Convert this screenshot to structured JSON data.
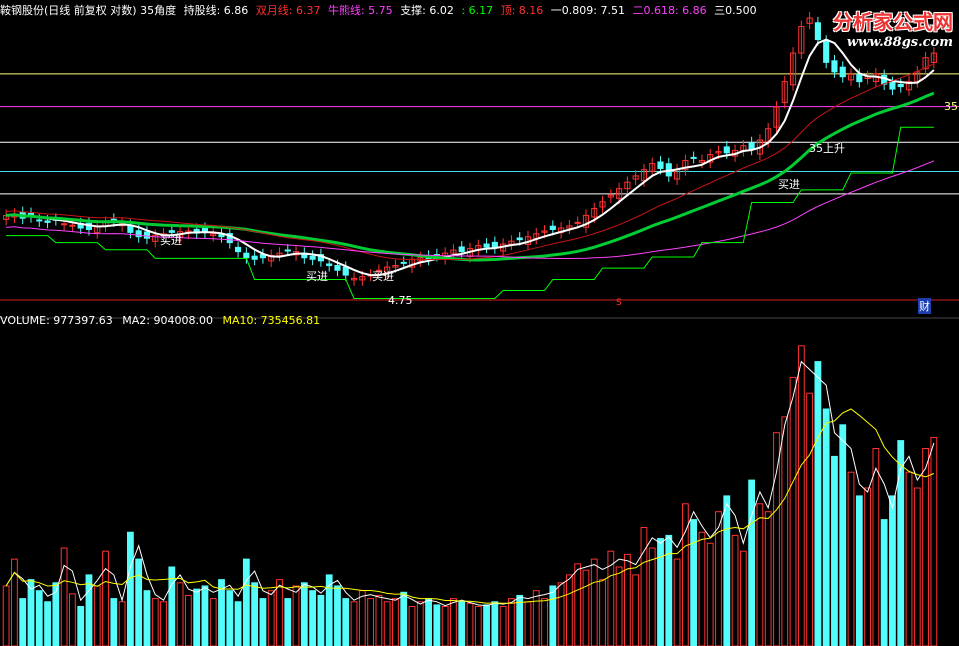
{
  "header": {
    "items": [
      {
        "text": "鞍钢股份(日线 前复权 对数) 35角度",
        "color": "#ffffff"
      },
      {
        "text": "持股线: 6.86",
        "color": "#ffffff"
      },
      {
        "text": "双月线: 6.37",
        "color": "#ff3030"
      },
      {
        "text": "牛熊线: 5.75",
        "color": "#ff40ff"
      },
      {
        "text": "支撑: 6.02",
        "color": "#ffffff"
      },
      {
        "text": ": 6.17",
        "color": "#00ff00"
      },
      {
        "text": "顶: 8.16",
        "color": "#ff3030"
      },
      {
        "text": "一0.809: 7.51",
        "color": "#ffffff"
      },
      {
        "text": "二0.618: 6.86",
        "color": "#ff40ff"
      },
      {
        "text": "三0.500",
        "color": "#ffffff"
      }
    ]
  },
  "volume_header": {
    "items": [
      {
        "text": "VOLUME: 977397.63",
        "color": "#ffffff"
      },
      {
        "text": "MA2: 904008.00",
        "color": "#ffffff"
      },
      {
        "text": "MA10: 735456.81",
        "color": "#ffff00"
      }
    ]
  },
  "watermark": {
    "title": "分析家公式网",
    "url": "www.88gs.com"
  },
  "annotations": {
    "buy": "买进",
    "up35": "35上升",
    "low_label": "4.75",
    "right_label": "35",
    "fin_badge": "财",
    "s_mark": "S"
  },
  "colors": {
    "up": "#ff3232",
    "down": "#54fcfc",
    "ma_white": "#ffffff",
    "ma_green": "#00cc33",
    "ma_red": "#c81414",
    "ma_magenta": "#ff40ff",
    "support": "#00ff00",
    "fib_top": "#ffff80",
    "fib_mag": "#ff40ff",
    "fib_white": "#ffffff",
    "fib_cyan": "#40e0e0",
    "bottom_red": "#d21e1e",
    "vol_ma2": "#ffffff",
    "vol_ma10": "#ffff00"
  },
  "chart_data": {
    "type": "candlestick",
    "closes": [
      5.7,
      5.72,
      5.66,
      5.68,
      5.62,
      5.6,
      5.64,
      5.58,
      5.56,
      5.52,
      5.5,
      5.55,
      5.6,
      5.62,
      5.58,
      5.46,
      5.4,
      5.38,
      5.42,
      5.44,
      5.46,
      5.47,
      5.48,
      5.45,
      5.46,
      5.44,
      5.4,
      5.32,
      5.2,
      5.12,
      5.1,
      5.12,
      5.15,
      5.18,
      5.22,
      5.2,
      5.12,
      5.1,
      5.08,
      5.02,
      4.96,
      4.9,
      4.86,
      4.88,
      4.9,
      4.96,
      5.0,
      5.02,
      5.06,
      5.1,
      5.12,
      5.1,
      5.15,
      5.18,
      5.22,
      5.2,
      5.24,
      5.28,
      5.26,
      5.25,
      5.3,
      5.34,
      5.36,
      5.4,
      5.44,
      5.48,
      5.5,
      5.52,
      5.55,
      5.6,
      5.7,
      5.8,
      5.9,
      6.0,
      6.1,
      6.2,
      6.3,
      6.4,
      6.5,
      6.42,
      6.3,
      6.4,
      6.55,
      6.6,
      6.55,
      6.65,
      6.7,
      6.68,
      6.72,
      6.8,
      6.74,
      6.9,
      7.1,
      7.5,
      8.0,
      8.6,
      9.2,
      9.4,
      8.9,
      8.4,
      8.2,
      8.1,
      8.15,
      8.0,
      8.1,
      8.16,
      7.95,
      7.85,
      7.9,
      8.0,
      8.2,
      8.5,
      8.6
    ],
    "volumes": [
      0.38,
      0.55,
      0.3,
      0.42,
      0.35,
      0.28,
      0.4,
      0.62,
      0.33,
      0.25,
      0.45,
      0.38,
      0.6,
      0.3,
      0.28,
      0.72,
      0.55,
      0.35,
      0.3,
      0.28,
      0.5,
      0.4,
      0.32,
      0.36,
      0.38,
      0.3,
      0.42,
      0.35,
      0.28,
      0.55,
      0.4,
      0.3,
      0.35,
      0.42,
      0.3,
      0.38,
      0.4,
      0.35,
      0.32,
      0.45,
      0.38,
      0.3,
      0.28,
      0.35,
      0.3,
      0.32,
      0.28,
      0.3,
      0.34,
      0.25,
      0.28,
      0.3,
      0.26,
      0.25,
      0.3,
      0.28,
      0.27,
      0.25,
      0.26,
      0.28,
      0.25,
      0.3,
      0.32,
      0.28,
      0.35,
      0.3,
      0.38,
      0.4,
      0.45,
      0.52,
      0.48,
      0.55,
      0.42,
      0.6,
      0.5,
      0.58,
      0.45,
      0.75,
      0.62,
      0.68,
      0.7,
      0.55,
      0.9,
      0.8,
      0.72,
      0.65,
      0.85,
      0.95,
      0.7,
      0.6,
      1.05,
      0.9,
      0.85,
      1.35,
      1.45,
      1.7,
      1.9,
      1.6,
      1.8,
      1.5,
      1.2,
      1.4,
      1.1,
      0.95,
      1.0,
      1.25,
      0.8,
      0.95,
      1.3,
      1.1,
      1.0,
      1.25,
      1.32
    ],
    "y_range": [
      4.6,
      9.4
    ],
    "volume_max": 2.0,
    "levels": {
      "top": 8.16,
      "fib_0809": 7.51,
      "fib_0618": 6.86,
      "fib_0500": 6.37,
      "support": 6.02,
      "low": 4.75
    }
  }
}
